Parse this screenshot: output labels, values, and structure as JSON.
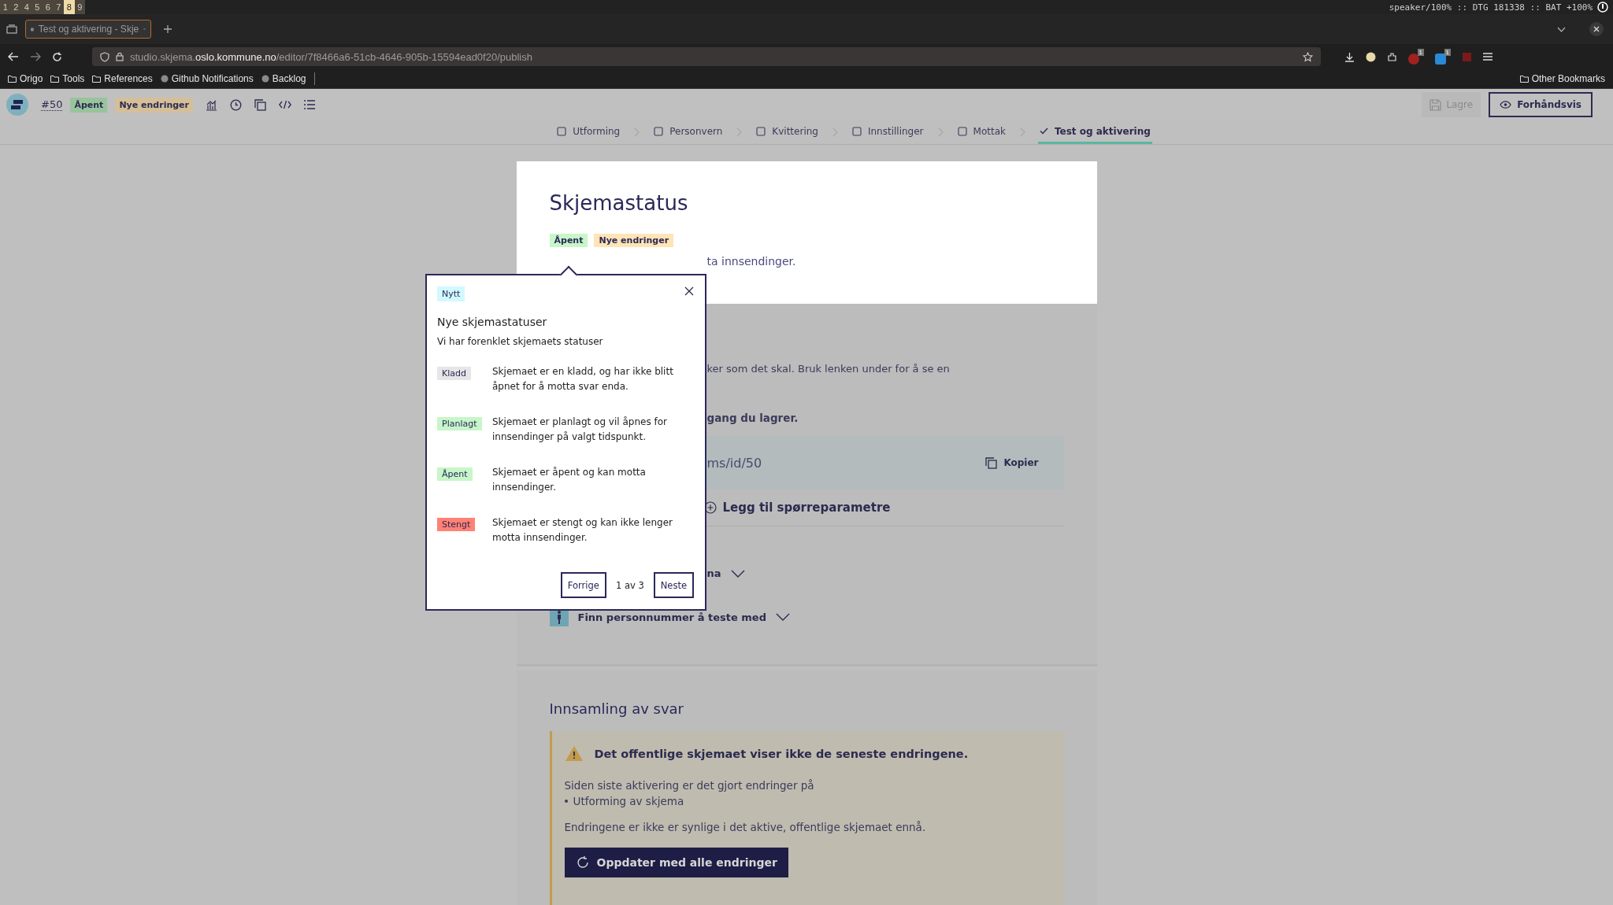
{
  "workspaces": [
    {
      "label": "1",
      "selected": false
    },
    {
      "label": "2",
      "selected": false
    },
    {
      "label": "4",
      "selected": false
    },
    {
      "label": "5",
      "selected": false
    },
    {
      "label": "6",
      "selected": false
    },
    {
      "label": "7",
      "selected": false
    },
    {
      "label": "8",
      "selected": true
    },
    {
      "label": "9",
      "selected": false
    }
  ],
  "system_status": "speaker/100% :: DTG 181338 :: BAT +100%",
  "browser_tab": {
    "title": "Test og aktivering - Skje"
  },
  "url": {
    "prefix": "studio.skjema.",
    "domain": "oslo.kommune.no",
    "path": "/editor/7f8466a6-51cb-4646-905b-15594ead0f20/publish"
  },
  "extensions": [
    {
      "badge": "1"
    },
    {
      "badge": "1"
    }
  ],
  "bookmarks": [
    {
      "label": "Origo",
      "kind": "folder"
    },
    {
      "label": "Tools",
      "kind": "folder"
    },
    {
      "label": "References",
      "kind": "folder"
    },
    {
      "label": "Github Notifications",
      "kind": "github"
    },
    {
      "label": "Backlog",
      "kind": "github"
    }
  ],
  "other_bookmarks": "Other Bookmarks",
  "app_header": {
    "form_number": "#50",
    "badges": [
      {
        "label": "Åpent",
        "color": "#98c49c"
      },
      {
        "label": "Nye endringer",
        "color": "#d4bf99"
      }
    ],
    "save_button": {
      "label": "Lagre",
      "disabled": true
    },
    "preview_button": "Forhåndsvis"
  },
  "steps": [
    {
      "label": "Utforming",
      "selected": false
    },
    {
      "label": "Personvern",
      "selected": false
    },
    {
      "label": "Kvittering",
      "selected": false
    },
    {
      "label": "Innstillinger",
      "selected": false
    },
    {
      "label": "Mottak",
      "selected": false
    },
    {
      "label": "Test og aktivering",
      "selected": true
    }
  ],
  "status_card": {
    "title": "Skjemastatus",
    "badges": [
      {
        "label": "Åpent",
        "color": "#c7f6c9"
      },
      {
        "label": "Nye endringer",
        "color": "#ffe4b5"
      }
    ],
    "text": "ta innsendinger."
  },
  "popup": {
    "tag": "Nytt",
    "title": "Nye skjemastatuser",
    "subtitle": "Vi har forenklet skjemaets statuser",
    "statuses": [
      {
        "label": "Kladd",
        "color": "#e6e6e6",
        "description": "Skjemaet er en kladd, og har ikke blitt åpnet for å motta svar enda."
      },
      {
        "label": "Planlagt",
        "color": "#c7f6c9",
        "description": "Skjemaet er planlagt og vil åpnes for innsendinger på valgt tidspunkt."
      },
      {
        "label": "Åpent",
        "color": "#c7f6c9",
        "description": "Skjemaet er åpent og kan motta innsendinger."
      },
      {
        "label": "Stengt",
        "color": "#ff8274",
        "description": "Skjemaet er stengt og kan ikke lenger motta innsendinger."
      }
    ],
    "prev_button": "Forrige",
    "page_indicator": "1 av 3",
    "next_button": "Neste"
  },
  "test_section": {
    "intro": "ker som det skal. Bruk lenken under for å se en",
    "note": "gang du lagrer.",
    "link": "ms/id/50",
    "copy_button": "Kopier",
    "add_params": "Legg til spørreparametre",
    "expander_1": "na",
    "expander_2": "Finn personnummer å teste med"
  },
  "collection": {
    "title": "Innsamling av svar",
    "alert_title": "Det offentlige skjemaet viser ikke de seneste endringene.",
    "body": "Siden siste aktivering er det gjort endringer på",
    "items": [
      "Utforming av skjema"
    ],
    "note": "Endringene er ikke er synlige i det aktive, offentlige skjemaet ennå.",
    "button": "Oppdater med alle endringer"
  }
}
